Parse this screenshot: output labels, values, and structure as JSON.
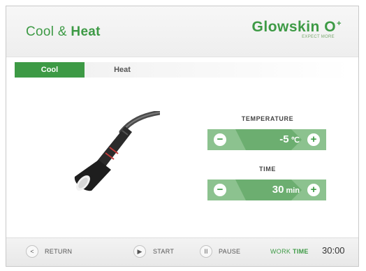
{
  "header": {
    "title_light": "Cool &",
    "title_strong": "Heat",
    "brand_name": "Glowskin O",
    "brand_sup": "+",
    "brand_tagline": "EXPECT MORE"
  },
  "tabs": [
    {
      "label": "Cool",
      "active": true
    },
    {
      "label": "Heat",
      "active": false
    }
  ],
  "temperature": {
    "label": "TEMPERATURE",
    "value": "-5",
    "unit": "℃",
    "minus": "−",
    "plus": "+"
  },
  "time": {
    "label": "TIME",
    "value": "30",
    "unit": "min",
    "minus": "−",
    "plus": "+"
  },
  "footer": {
    "return_icon": "chevron-left-icon",
    "return_glyph": "<",
    "return_label": "RETURN",
    "start_icon": "play-icon",
    "start_glyph": "▶",
    "start_label": "START",
    "pause_icon": "pause-icon",
    "pause_glyph": "II",
    "pause_label": "PAUSE",
    "work_label_light": "WORK",
    "work_label_strong": "TIME",
    "work_time": "30:00"
  },
  "colors": {
    "accent": "#3d9a45",
    "control_bg": "#8cc28f"
  }
}
